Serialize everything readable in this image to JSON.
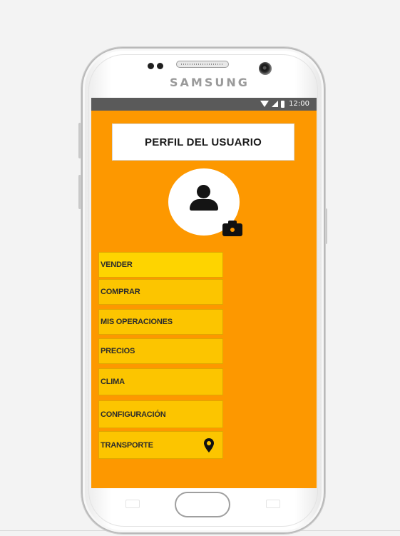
{
  "device": {
    "brand": "SAMSUNG"
  },
  "status_bar": {
    "time": "12:00",
    "icons": [
      "wifi-icon",
      "signal-icon",
      "battery-icon"
    ]
  },
  "profile": {
    "title": "PERFIL DEL USUARIO",
    "avatar_icon": "person-icon",
    "camera_icon": "camera-icon"
  },
  "menu": {
    "items": [
      {
        "label": "VENDER"
      },
      {
        "label": "COMPRAR"
      },
      {
        "label": "MIS OPERACIONES"
      },
      {
        "label": "PRECIOS"
      },
      {
        "label": "CLIMA"
      },
      {
        "label": "CONFIGURACIÓN"
      },
      {
        "label": "TRANSPORTE",
        "icon": "location-pin-icon"
      }
    ]
  },
  "colors": {
    "screen_background": "#fd9800",
    "menu_item": "#fcc500",
    "menu_item_active": "#fed400",
    "status_bar": "#5a5a5a"
  }
}
